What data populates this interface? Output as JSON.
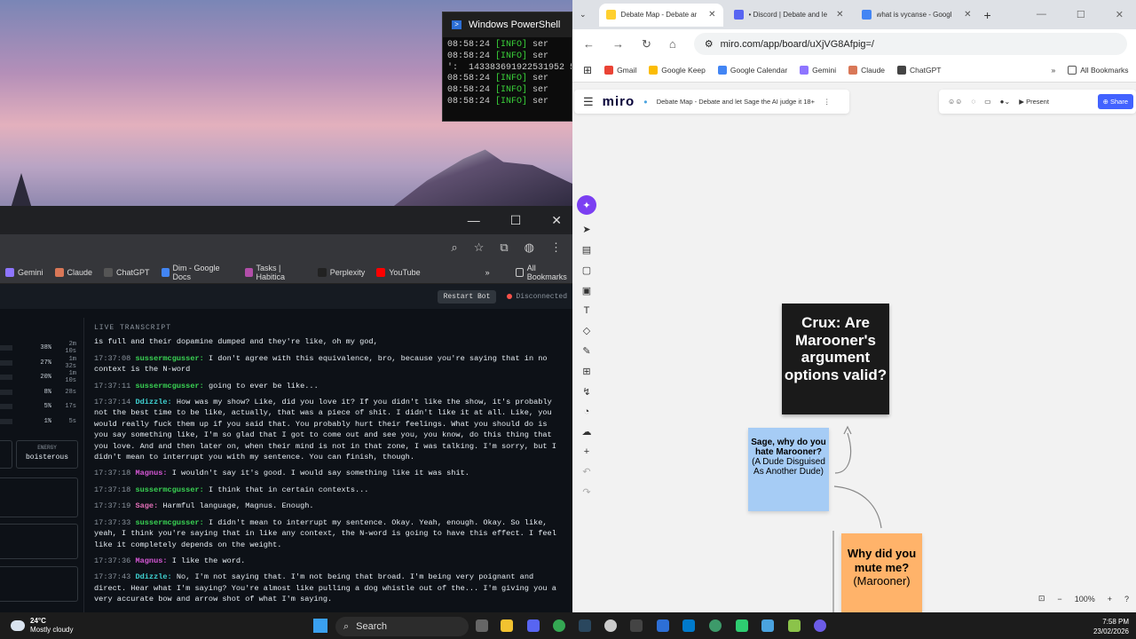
{
  "powershell": {
    "title": "Windows PowerShell",
    "lines": [
      {
        "time": "08:58:24",
        "level": "[INFO]",
        "rest": " ser"
      },
      {
        "time": "08:58:24",
        "level": "[INFO]",
        "rest": " ser"
      },
      {
        "time": "':",
        "level": "",
        "rest": " 143383691922531952 5,"
      },
      {
        "time": "08:58:24",
        "level": "[INFO]",
        "rest": " ser"
      },
      {
        "time": "08:58:24",
        "level": "[INFO]",
        "rest": " ser"
      },
      {
        "time": "08:58:24",
        "level": "[INFO]",
        "rest": " ser"
      }
    ]
  },
  "left_browser": {
    "bookmarks": [
      "Gemini",
      "Claude",
      "ChatGPT",
      "Dim - Google Docs",
      "Tasks | Habitica",
      "Perplexity",
      "YouTube"
    ],
    "all_bookmarks": "All Bookmarks",
    "restart": "Restart Bot",
    "status": "Disconnected",
    "stats": [
      {
        "p": "38%",
        "t": "2m 10s"
      },
      {
        "p": "27%",
        "t": "1m 32s"
      },
      {
        "p": "20%",
        "t": "1m 10s"
      },
      {
        "p": "8%",
        "t": "28s"
      },
      {
        "p": "5%",
        "t": "17s"
      },
      {
        "p": "1%",
        "t": "5s"
      }
    ],
    "energy_label": "ENERGY",
    "energy_value": "boisterous",
    "transcript_header": "LIVE TRANSCRIPT",
    "transcript": [
      {
        "ts": "",
        "sp": "",
        "color": "#ffffff",
        "text": "is full and their dopamine dumped and they're like, oh my god,"
      },
      {
        "ts": "17:37:08",
        "sp": "sussermcgusser:",
        "color": "#39d353",
        "text": "I don't agree with this equivalence, bro, because you're saying that in no context is the N-word"
      },
      {
        "ts": "17:37:11",
        "sp": "sussermcgusser:",
        "color": "#39d353",
        "text": "going to ever be like..."
      },
      {
        "ts": "17:37:14",
        "sp": "Ddizzle:",
        "color": "#3fd0d0",
        "text": "How was my show? Like, did you love it? If you didn't like the show, it's probably not the best time to be like, actually, that was a piece of shit. I didn't like it at all. Like, you would really fuck them up if you said that. You probably hurt their feelings. What you should do is you say something like, I'm so glad that I got to come out and see you, you know, do this thing that you love. And and then later on, when their mind is not in that zone, I was talking. I'm sorry, but I didn't mean to interrupt you with my sentence. You can finish, though."
      },
      {
        "ts": "17:37:18",
        "sp": "Magnus:",
        "color": "#d657d6",
        "text": "I wouldn't say it's good. I would say something like it was shit."
      },
      {
        "ts": "17:37:18",
        "sp": "sussermcgusser:",
        "color": "#39d353",
        "text": "I think that in certain contexts..."
      },
      {
        "ts": "17:37:19",
        "sp": "Sage:",
        "color": "#e36fb8",
        "text": "Harmful language, Magnus. Enough."
      },
      {
        "ts": "17:37:33",
        "sp": "sussermcgusser:",
        "color": "#39d353",
        "text": "I didn't mean to interrupt my sentence. Okay. Yeah, enough. Okay. So like, yeah, I think you're saying that in like any context, the N-word is going to have this effect. I feel like it completely depends on the weight."
      },
      {
        "ts": "17:37:36",
        "sp": "Magnus:",
        "color": "#d657d6",
        "text": "I like the word."
      },
      {
        "ts": "17:37:43",
        "sp": "Ddizzle:",
        "color": "#3fd0d0",
        "text": "No, I'm not saying that. I'm not being that broad. I'm being very poignant and direct. Hear what I'm saying? You're almost like pulling a dog whistle out of the... I'm giving you a very accurate bow and arrow shot of what I'm saying."
      }
    ]
  },
  "miro_browser": {
    "tabs": [
      {
        "label": "Debate Map - Debate ar",
        "color": "#ffd02f"
      },
      {
        "label": "• Discord | Debate and le",
        "color": "#5865f2"
      },
      {
        "label": "what is vycanse - Googl",
        "color": "#4285f4"
      }
    ],
    "url": "miro.com/app/board/uXjVG8Afpig=/",
    "bookmarks": [
      {
        "label": "Gmail",
        "color": "#ea4335"
      },
      {
        "label": "Google Keep",
        "color": "#fbbc04"
      },
      {
        "label": "Google Calendar",
        "color": "#4285f4"
      },
      {
        "label": "Gemini",
        "color": "#8e75ff"
      },
      {
        "label": "Claude",
        "color": "#d97757"
      },
      {
        "label": "ChatGPT",
        "color": "#444444"
      }
    ],
    "all_bookmarks": "All Bookmarks",
    "logo": "miro",
    "board_title": "Debate Map - Debate and let Sage the AI judge it 18+",
    "present": "▶ Present",
    "share": "⊕ Share",
    "crux": "Crux: Are Marooner's argument options valid?",
    "note1_title": "Sage, why do you hate Marooner?",
    "note1_sub": "(A Dude Disguised As Another Dude)",
    "note2_title": "Why did you mute me?",
    "note2_sub": "(Marooner)",
    "zoom": "100%"
  },
  "taskbar": {
    "temp": "24°C",
    "weather": "Mostly cloudy",
    "search": "Search",
    "time": "7:58 PM",
    "date": "23/02/2026"
  }
}
